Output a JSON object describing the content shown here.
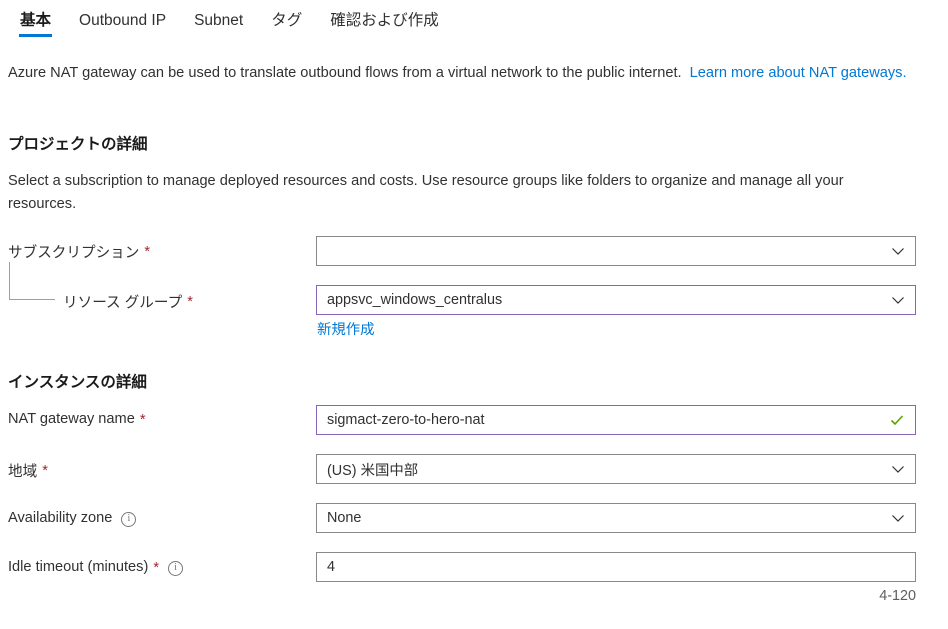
{
  "tabs": [
    {
      "label": "基本",
      "active": true
    },
    {
      "label": "Outbound IP",
      "active": false
    },
    {
      "label": "Subnet",
      "active": false
    },
    {
      "label": "タグ",
      "active": false
    },
    {
      "label": "確認および作成",
      "active": false
    }
  ],
  "intro": {
    "text": "Azure NAT gateway can be used to translate outbound flows from a virtual network to the public internet.",
    "link_label": "Learn more about NAT gateways."
  },
  "project_details": {
    "title": "プロジェクトの詳細",
    "description": "Select a subscription to manage deployed resources and costs. Use resource groups like folders to organize and manage all your resources.",
    "subscription": {
      "label": "サブスクリプション",
      "required_marker": "*",
      "value": "",
      "redacted": true
    },
    "resource_group": {
      "label": "リソース グループ",
      "required_marker": "*",
      "value": "appsvc_windows_centralus",
      "create_new_label": "新規作成"
    }
  },
  "instance_details": {
    "title": "インスタンスの詳細",
    "nat_gateway_name": {
      "label": "NAT gateway name",
      "required_marker": "*",
      "value": "sigmact-zero-to-hero-nat",
      "validated": true
    },
    "region": {
      "label": "地域",
      "required_marker": "*",
      "value": "(US) 米国中部"
    },
    "availability_zone": {
      "label": "Availability zone",
      "value": "None"
    },
    "idle_timeout": {
      "label": "Idle timeout (minutes)",
      "required_marker": "*",
      "value": "4",
      "hint": "4-120"
    }
  },
  "colors": {
    "accent_blue": "#0078d4",
    "focus_purple": "#8764b8",
    "required_red": "#a4262c",
    "valid_green": "#57a300",
    "border_gray": "#8a8886",
    "text": "#323130"
  }
}
